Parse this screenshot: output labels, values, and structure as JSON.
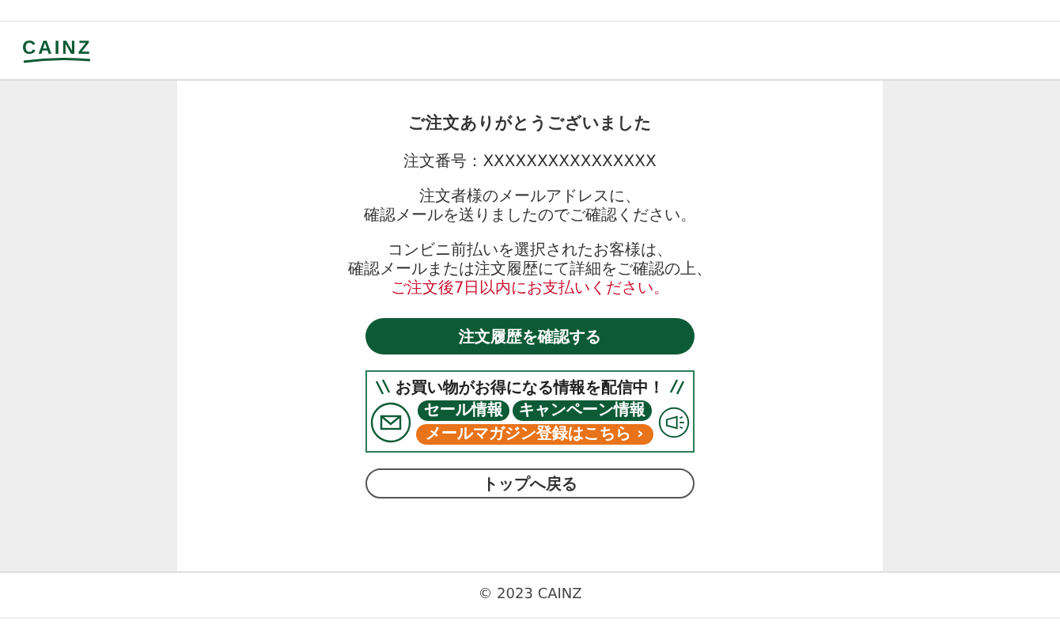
{
  "header": {
    "logo": "CAINZ"
  },
  "main": {
    "title": "ご注文ありがとうございました",
    "order_number": "注文番号：XXXXXXXXXXXXXXXX",
    "mail_notice": [
      "注文者様のメールアドレスに、",
      "確認メールを送りましたのでご確認ください。"
    ],
    "convenience_notice": [
      "コンビニ前払いを選択されたお客様は、",
      "確認メールまたは注文履歴にて詳細をご確認の上、"
    ],
    "deadline_notice": "ご注文後7日以内にお支払いください。",
    "history_button": "注文履歴を確認する",
    "banner": {
      "headline": "お買い物がお得になる情報を配信中！",
      "tags": [
        "セール情報",
        "キャンペーン情報"
      ],
      "button": "メールマガジン登録はこちら ›"
    },
    "top_button": "トップへ戻る"
  },
  "footer": {
    "copyright": "© 2023 CAINZ"
  }
}
